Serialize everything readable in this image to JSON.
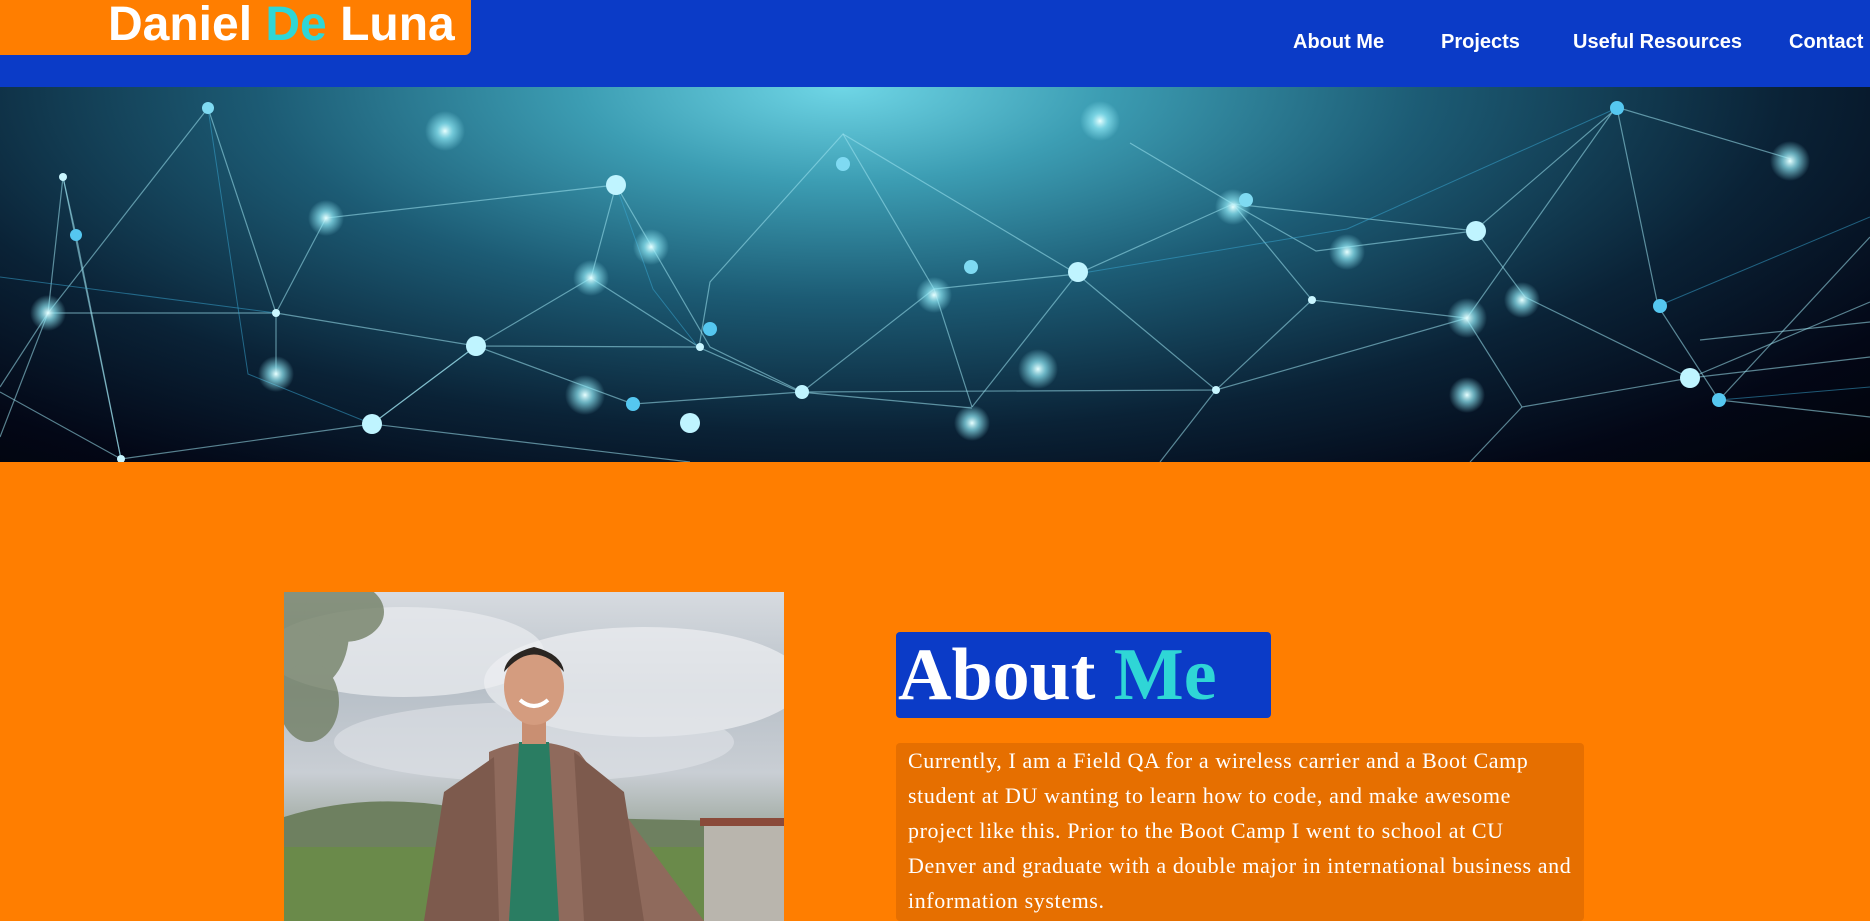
{
  "header": {
    "brand_first": "Daniel",
    "brand_accent": "De",
    "brand_last": "Luna",
    "nav": [
      {
        "label": "About Me"
      },
      {
        "label": "Projects"
      },
      {
        "label": "Useful Resources"
      },
      {
        "label": "Contact"
      }
    ]
  },
  "about": {
    "title_main": "About",
    "title_accent": "Me",
    "paragraph": "Currently, I am a Field QA for a wireless carrier and a Boot Camp student at DU wanting to learn how to code, and make awesome project like this. Prior to the Boot Camp I went to school at CU Denver and graduate with a double major in international business and information systems."
  },
  "colors": {
    "header_bg": "#0b3bc7",
    "page_bg": "#ff7e00",
    "accent_teal": "#2fd6d6",
    "text_box_bg": "#e66f00"
  },
  "images": {
    "hero": "network-lines-banner",
    "profile": "profile-photo-man-in-brown-blazer"
  }
}
